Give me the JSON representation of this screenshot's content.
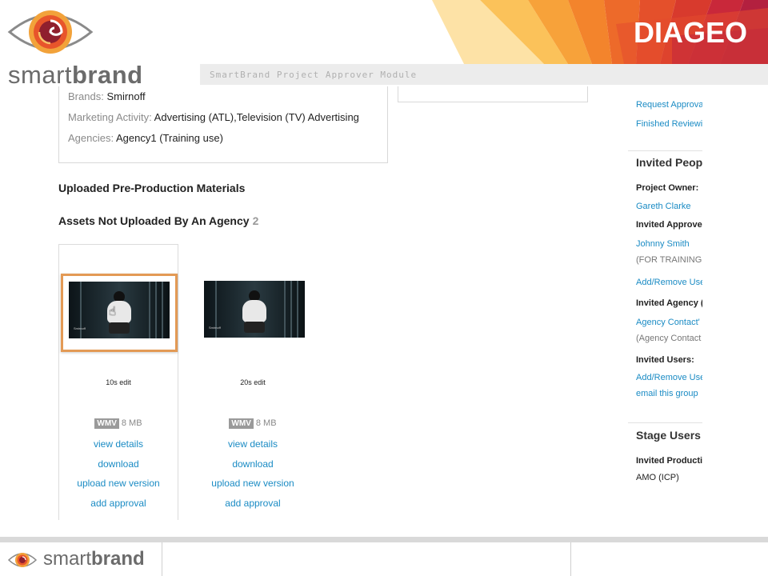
{
  "header": {
    "brand_light": "smart",
    "brand_bold": "brand",
    "module_title": "SmartBrand Project Approver Module",
    "client_logo": "DIAGEO"
  },
  "project_info": {
    "brands_label": "Brands:",
    "brands_value": "Smirnoff",
    "marketing_label": "Marketing Activity:",
    "marketing_value": "Advertising (ATL),Television (TV) Advertising",
    "agencies_label": "Agencies:",
    "agencies_value": "Agency1 (Training use)"
  },
  "sections": {
    "uploaded_title": "Uploaded Pre-Production Materials",
    "not_uploaded_title": "Assets Not Uploaded By An Agency",
    "not_uploaded_count": "2"
  },
  "assets": [
    {
      "name": "10s edit",
      "format": "WMV",
      "size": "8 MB",
      "thumb_caption": "Smirnoff",
      "links": {
        "view": "view details",
        "download": "download",
        "upload": "upload new version",
        "approval": "add approval"
      }
    },
    {
      "name": "20s edit",
      "format": "WMV",
      "size": "8 MB",
      "thumb_caption": "Smirnoff",
      "links": {
        "view": "view details",
        "download": "download",
        "upload": "upload new version",
        "approval": "add approval"
      }
    }
  ],
  "sidebar": {
    "request_approval": "Request Approva",
    "finished_reviewing": "Finished Reviewi",
    "invited_people_heading": "Invited Peop",
    "project_owner_label": "Project Owner:",
    "project_owner_name": "Gareth Clarke",
    "invited_approvers_label": "Invited Approve",
    "approver_name": "Johnny Smith",
    "approver_note": "(FOR TRAINING (",
    "add_remove_users_1": "Add/Remove Use",
    "invited_agency_label": "Invited Agency (",
    "agency_contact": "Agency Contact'",
    "agency_contact_note": "(Agency Contact",
    "invited_users_label": "Invited Users:",
    "add_remove_users_2": "Add/Remove Use",
    "email_group": "email this group",
    "stage_users_heading": "Stage Users",
    "invited_production_label": "Invited Productio",
    "production_value": "AMO (ICP)"
  },
  "footer": {
    "brand_light": "smart",
    "brand_bold": "brand"
  },
  "colors": {
    "link": "#1a8bc4",
    "selection": "#e39a55",
    "brand_gray": "#6b6b6b"
  }
}
